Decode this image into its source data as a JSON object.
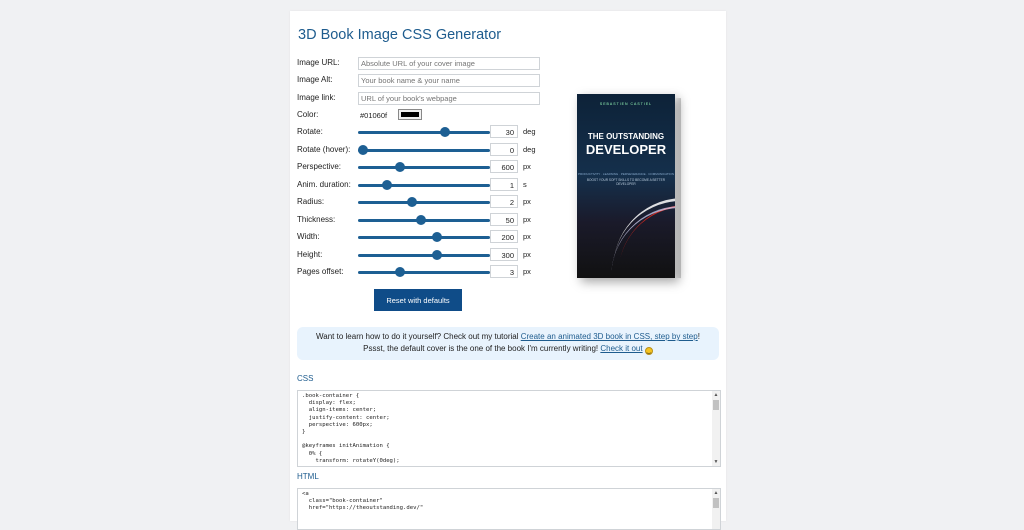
{
  "title": "3D Book Image CSS Generator",
  "fields": [
    {
      "label": "Image URL:",
      "placeholder": "Absolute URL of your cover image"
    },
    {
      "label": "Image Alt:",
      "placeholder": "Your book name & your name"
    },
    {
      "label": "Image link:",
      "placeholder": "URL of your book's webpage"
    }
  ],
  "color": {
    "label": "Color:",
    "value": "#01060f",
    "swatch": "#000000"
  },
  "sliders": [
    {
      "label": "Rotate:",
      "value": "30",
      "unit": "deg",
      "position": 0.66
    },
    {
      "label": "Rotate (hover):",
      "value": "0",
      "unit": "deg",
      "position": 0.04
    },
    {
      "label": "Perspective:",
      "value": "600",
      "unit": "px",
      "position": 0.32
    },
    {
      "label": "Anim. duration:",
      "value": "1",
      "unit": "s",
      "position": 0.22
    },
    {
      "label": "Radius:",
      "value": "2",
      "unit": "px",
      "position": 0.41
    },
    {
      "label": "Thickness:",
      "value": "50",
      "unit": "px",
      "position": 0.48
    },
    {
      "label": "Width:",
      "value": "200",
      "unit": "px",
      "position": 0.6
    },
    {
      "label": "Height:",
      "value": "300",
      "unit": "px",
      "position": 0.6
    },
    {
      "label": "Pages offset:",
      "value": "3",
      "unit": "px",
      "position": 0.32
    }
  ],
  "reset_label": "Reset with defaults",
  "book": {
    "author": "SEBASTIEN CASTIEL",
    "title_line1": "THE OUTSTANDING",
    "title_line2": "DEVELOPER",
    "tags": "PRODUCTIVITY · LEARNING · PERSEVERANCE · COMMUNICATION",
    "subtitle": "BOOST YOUR SOFT SKILLS TO BECOME A BETTER DEVELOPER"
  },
  "info": {
    "line1_text": "Want to learn how to do it yourself? Check out my tutorial ",
    "line1_link": "Create an animated 3D book in CSS, step by step",
    "line1_end": "!",
    "line2_text": "Pssst, the default cover is the one of the book I'm currently writing! ",
    "line2_link": "Check it out"
  },
  "css_label": "CSS",
  "css_code": ".book-container {\n  display: flex;\n  align-items: center;\n  justify-content: center;\n  perspective: 600px;\n}\n\n@keyframes initAnimation {\n  0% {\n    transform: rotateY(0deg);",
  "html_label": "HTML",
  "html_code": "<a\n  class=\"book-container\"\n  href=\"https://theoutstanding.dev/\""
}
